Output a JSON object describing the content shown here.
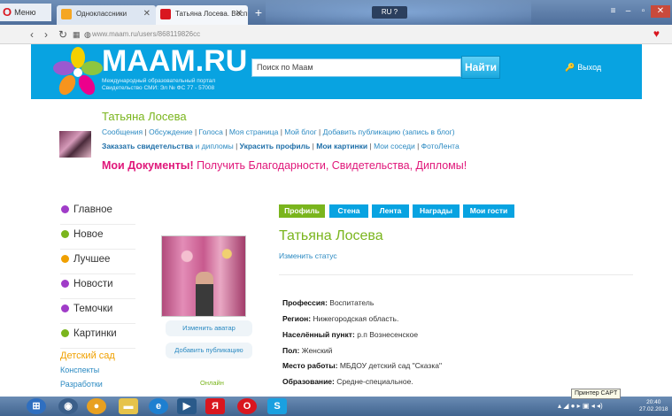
{
  "browser": {
    "menu_label": "Меню",
    "tabs": [
      {
        "label": "Одноклассники",
        "favicon_color": "#f5a623"
      },
      {
        "label": "Татьяна Лосева. Воспита",
        "favicon_color": "#d9161f"
      }
    ],
    "new_tab_symbol": "+",
    "lang_indicator": "RU",
    "url": "www.maam.ru/users/868119826cc"
  },
  "header": {
    "logo_text": "MAAM.RU",
    "logo_subtitle": "Международный образовательный портал Свидетельство СМИ: Эл № ФС 77 - 57008",
    "search_placeholder": "Поиск по Маам",
    "search_button": "Найти",
    "exit_label": "Выход",
    "bg_color": "#08a3e1"
  },
  "profile_header": {
    "user_name": "Татьяна Лосева",
    "links_row1": [
      "Сообщения",
      "Обсуждение",
      "Голоса",
      "Моя страница",
      "Мой блог",
      "Добавить публикацию (запись в блог)"
    ],
    "links_row2": {
      "order_cert": "Заказать свидетельства",
      "and_diplomas": " и дипломы",
      "decorate": "Украсить профиль",
      "my_pictures": "Мои картинки",
      "neighbors": "Мои соседи",
      "photofeed": "ФотоЛента"
    },
    "docs_bold": "Мои Документы!",
    "docs_rest": " Получить Благодарности, Свидетельства, Дипломы!"
  },
  "left_nav": {
    "items": [
      {
        "label": "Главное",
        "color": "#a03cc8"
      },
      {
        "label": "Новое",
        "color": "#7ab51d"
      },
      {
        "label": "Лучшее",
        "color": "#f0a000"
      },
      {
        "label": "Новости",
        "color": "#a03cc8"
      },
      {
        "label": "Темочки",
        "color": "#a03cc8"
      },
      {
        "label": "Картинки",
        "color": "#7ab51d"
      }
    ],
    "section_title": "Детский сад",
    "sub_items": [
      "Конспекты",
      "Разработки"
    ]
  },
  "avatar_column": {
    "change_avatar": "Изменить аватар",
    "add_publication": "Добавить публикацию",
    "online": "Онлайн"
  },
  "profile": {
    "tabs": [
      "Профиль",
      "Стена",
      "Лента",
      "Награды",
      "Мои гости"
    ],
    "name": "Татьяна Лосева",
    "change_status": "Изменить статус",
    "fields": [
      {
        "label": "Профессия:",
        "value": "Воспитатель"
      },
      {
        "label": "Регион:",
        "value": "Нижегородская область."
      },
      {
        "label": "Населённый пункт:",
        "value": "р.п Вознесенское"
      },
      {
        "label": "Пол:",
        "value": "Женский"
      },
      {
        "label": "Место работы:",
        "value": "МБДОУ детский сад \"Сказка\""
      },
      {
        "label": "Образование:",
        "value": "Средне-специальное."
      }
    ]
  },
  "taskbar": {
    "tooltip": "Принтер CAPT",
    "time": "20:40",
    "date": "27.02.2018"
  }
}
